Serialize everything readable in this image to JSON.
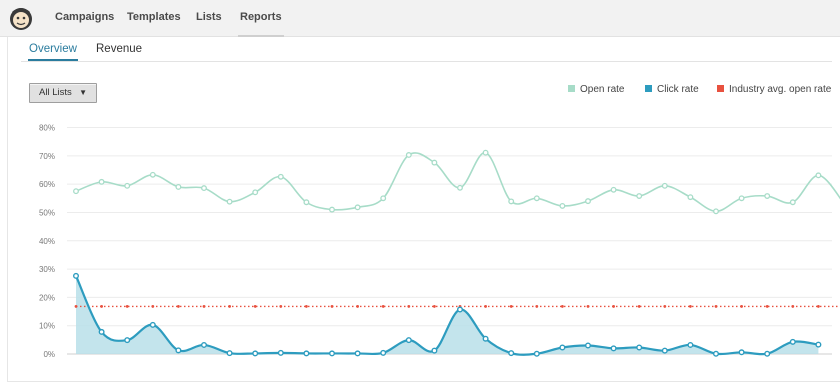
{
  "nav": {
    "items": [
      {
        "label": "Campaigns",
        "active": false
      },
      {
        "label": "Templates",
        "active": false
      },
      {
        "label": "Lists",
        "active": false
      },
      {
        "label": "Reports",
        "active": true
      }
    ]
  },
  "tabs": [
    {
      "label": "Overview",
      "active": true
    },
    {
      "label": "Revenue",
      "active": false
    }
  ],
  "filter": {
    "selected": "All Lists"
  },
  "colors": {
    "open_rate": "#a7dcc8",
    "click_rate": "#2d9cbf",
    "industry": "#e8513f",
    "click_fill": "#b9dfe9"
  },
  "chart_data": {
    "type": "line",
    "yticks": [
      "80%",
      "70%",
      "60%",
      "50%",
      "40%",
      "30%",
      "20%",
      "10%",
      "0%"
    ],
    "ylim": [
      0,
      80
    ],
    "legend": {
      "position": "top-right",
      "entries": [
        "Open rate",
        "Click rate",
        "Industry avg. open rate"
      ]
    },
    "series": [
      {
        "name": "Open rate",
        "values": [
          57.5,
          60.8,
          59.4,
          63.3,
          59,
          58.6,
          53.8,
          57.1,
          62.6,
          53.6,
          51,
          51.8,
          55,
          70.3,
          67.6,
          58.7,
          71.1,
          53.9,
          55,
          52.3,
          54,
          58,
          55.8,
          59.4,
          55.4,
          50.4,
          55,
          55.8,
          53.6,
          63.1,
          53.2
        ]
      },
      {
        "name": "Click rate",
        "values": [
          27.6,
          7.8,
          4.9,
          10.3,
          1.3,
          3.2,
          0.3,
          0.2,
          0.4,
          0.2,
          0.2,
          0.2,
          0.4,
          4.9,
          1.2,
          15.7,
          5.4,
          0.3,
          0.1,
          2.3,
          3,
          2,
          2.3,
          1.2,
          3.2,
          0.1,
          0.6,
          0.1,
          4.3,
          3.3
        ]
      },
      {
        "name": "Industry avg. open rate",
        "constant": 16.8,
        "points": 31
      }
    ]
  }
}
